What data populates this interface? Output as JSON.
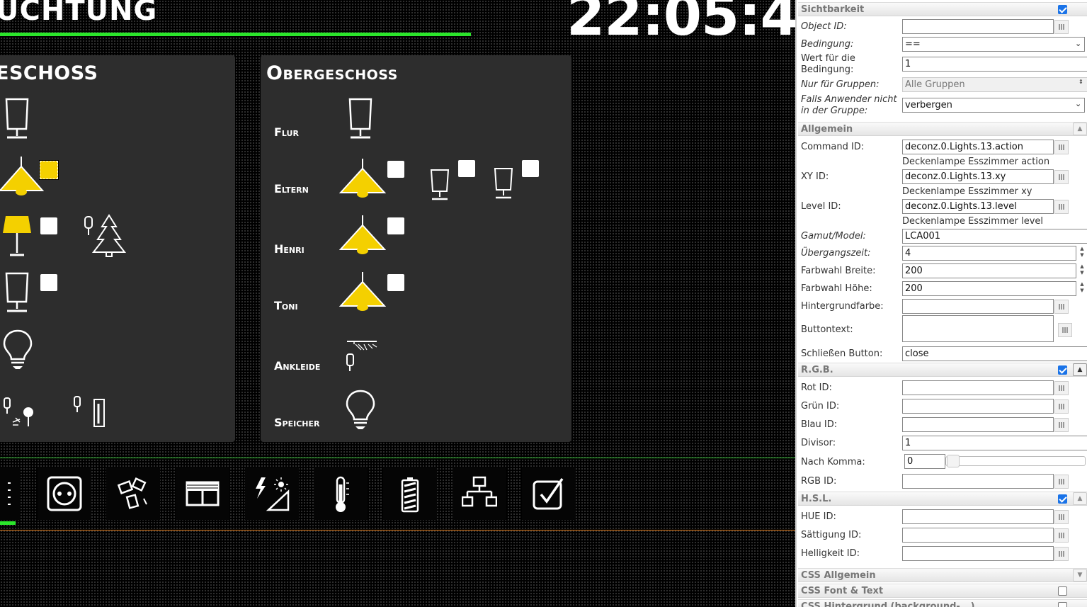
{
  "view": {
    "title_fragment": "UCHTUNG",
    "clock": "22:05:4"
  },
  "panels": {
    "left": {
      "title": "ESCHOSS"
    },
    "right": {
      "title": "Obergeschoss",
      "rooms": [
        "Flur",
        "Eltern",
        "Henri",
        "Toni",
        "Ankleide",
        "Speicher"
      ]
    }
  },
  "navbar": {
    "icons": [
      "menu-icon",
      "socket-icon",
      "window-contact-icon",
      "shutter-icon",
      "weather-icon",
      "thermometer-icon",
      "battery-icon",
      "network-icon",
      "checkbox-icon"
    ]
  },
  "colors": {
    "accent_green": "#2be52b",
    "lamp_yellow": "#f4d000",
    "orange_line": "#e07a1c",
    "panel_bg": "#2d2d2d"
  },
  "props": {
    "visibility": {
      "header": "Sichtbarkeit",
      "checked": true,
      "object_id_label": "Object ID:",
      "object_id_value": "",
      "condition_label": "Bedingung:",
      "condition_value": "==",
      "condition_value_label": "Wert für die Bedingung:",
      "condition_value_value": "1",
      "groups_label": "Nur für Gruppen:",
      "groups_value": "Alle Gruppen",
      "not_in_group_label": "Falls Anwender nicht in der Gruppe:",
      "not_in_group_value": "verbergen"
    },
    "general": {
      "header": "Allgemein",
      "command_id_label": "Command ID:",
      "command_id_value": "deconz.0.Lights.13.action",
      "command_id_desc": "Deckenlampe Esszimmer action",
      "xy_id_label": "XY ID:",
      "xy_id_value": "deconz.0.Lights.13.xy",
      "xy_id_desc": "Deckenlampe Esszimmer xy",
      "level_id_label": "Level ID:",
      "level_id_value": "deconz.0.Lights.13.level",
      "level_id_desc": "Deckenlampe Esszimmer level",
      "gamut_label": "Gamut/Model:",
      "gamut_value": "LCA001",
      "transition_label": "Übergangszeit:",
      "transition_value": "4",
      "picker_width_label": "Farbwahl Breite:",
      "picker_width_value": "200",
      "picker_height_label": "Farbwahl Höhe:",
      "picker_height_value": "200",
      "bg_color_label": "Hintergrundfarbe:",
      "bg_color_value": "",
      "button_text_label": "Buttontext:",
      "button_text_value": "",
      "close_button_label": "Schließen Button:",
      "close_button_value": "close"
    },
    "rgb": {
      "header": "R.G.B.",
      "checked": true,
      "red_label": "Rot ID:",
      "green_label": "Grün ID:",
      "blue_label": "Blau ID:",
      "divisor_label": "Divisor:",
      "divisor_value": "1",
      "decimals_label": "Nach Komma:",
      "decimals_value": "0",
      "rgb_id_label": "RGB ID:"
    },
    "hsl": {
      "header": "H.S.L.",
      "checked": true,
      "hue_label": "HUE ID:",
      "saturation_label": "Sättigung ID:",
      "brightness_label": "Helligkeit ID:"
    },
    "css_general": {
      "header": "CSS Allgemein"
    },
    "css_font": {
      "header": "CSS Font & Text",
      "checked": false
    },
    "css_bg": {
      "header": "CSS Hintergrund (background-...)",
      "checked": false
    }
  }
}
